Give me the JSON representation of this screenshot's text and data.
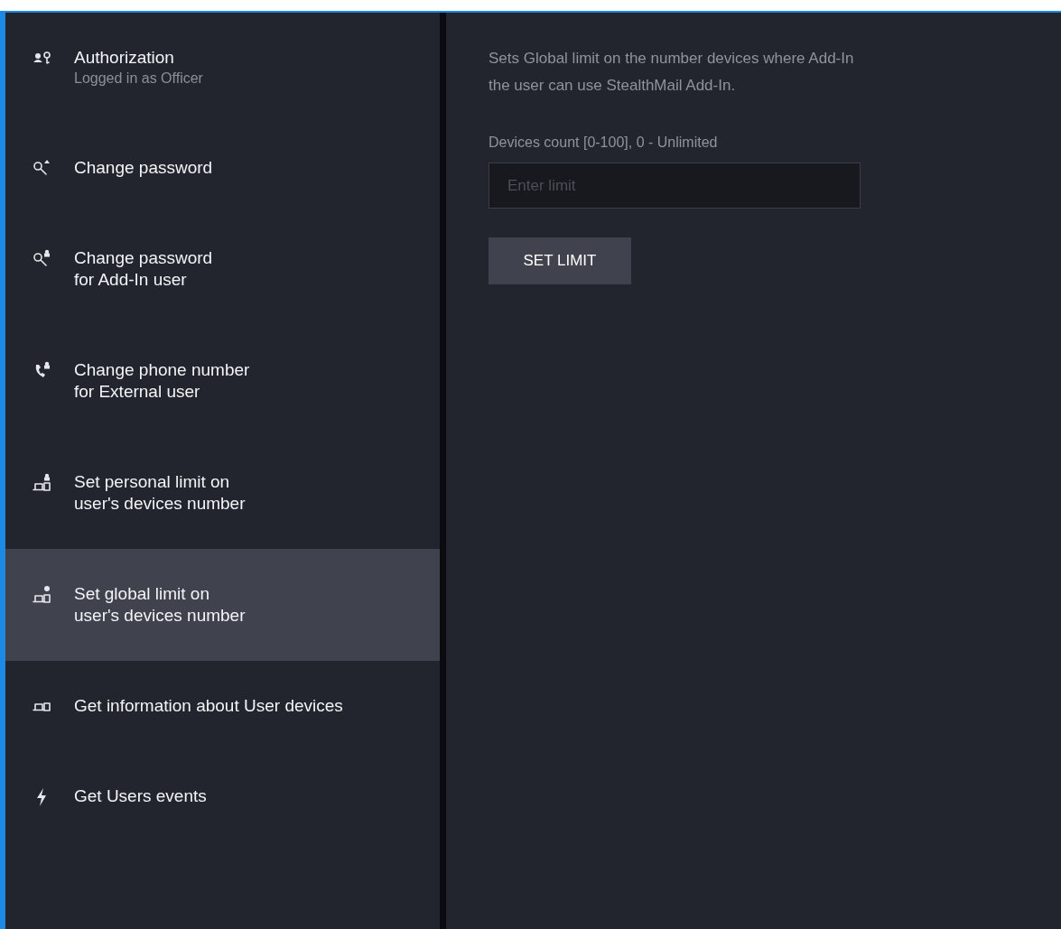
{
  "sidebar": {
    "items": [
      {
        "label": "Authorization",
        "sublabel": "Logged in as Officer",
        "selected": false
      },
      {
        "label": "Change password",
        "selected": false
      },
      {
        "label": "Change password\nfor Add-In user",
        "selected": false
      },
      {
        "label": "Change phone number\nfor External user",
        "selected": false
      },
      {
        "label": "Set personal limit on\nuser's devices number",
        "selected": false
      },
      {
        "label": "Set global limit on\nuser's devices number",
        "selected": true
      },
      {
        "label": "Get information about User devices",
        "selected": false
      },
      {
        "label": "Get Users events",
        "selected": false
      }
    ]
  },
  "content": {
    "description": "Sets Global limit on the number devices where Add-In\nthe user can use StealthMail Add-In.",
    "field_label": "Devices count [0-100], 0 - Unlimited",
    "field": {
      "placeholder": "Enter limit"
    },
    "button": "SET LIMIT"
  }
}
